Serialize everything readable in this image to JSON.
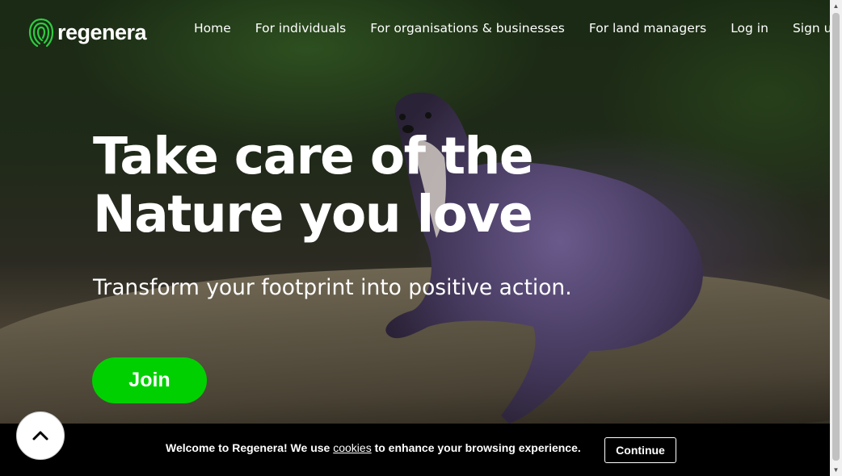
{
  "brand": {
    "name": "regenera",
    "color": "#2ecc40"
  },
  "nav": {
    "items": [
      "Home",
      "For individuals",
      "For organisations & businesses",
      "For land managers",
      "Log in",
      "Sign up"
    ]
  },
  "hero": {
    "headline_line1": "Take care of the",
    "headline_line2": "Nature you love",
    "subtitle": "Transform your footprint into positive action.",
    "join_label": "Join",
    "accent": "#00d000"
  },
  "cookie": {
    "text_before": "Welcome to Regenera! We use ",
    "link": "cookies",
    "text_after": " to enhance your browsing experience.",
    "continue_label": "Continue"
  },
  "icons": {
    "scroll_top": "chevron-up-icon",
    "logo": "fingerprint-logo-icon"
  }
}
